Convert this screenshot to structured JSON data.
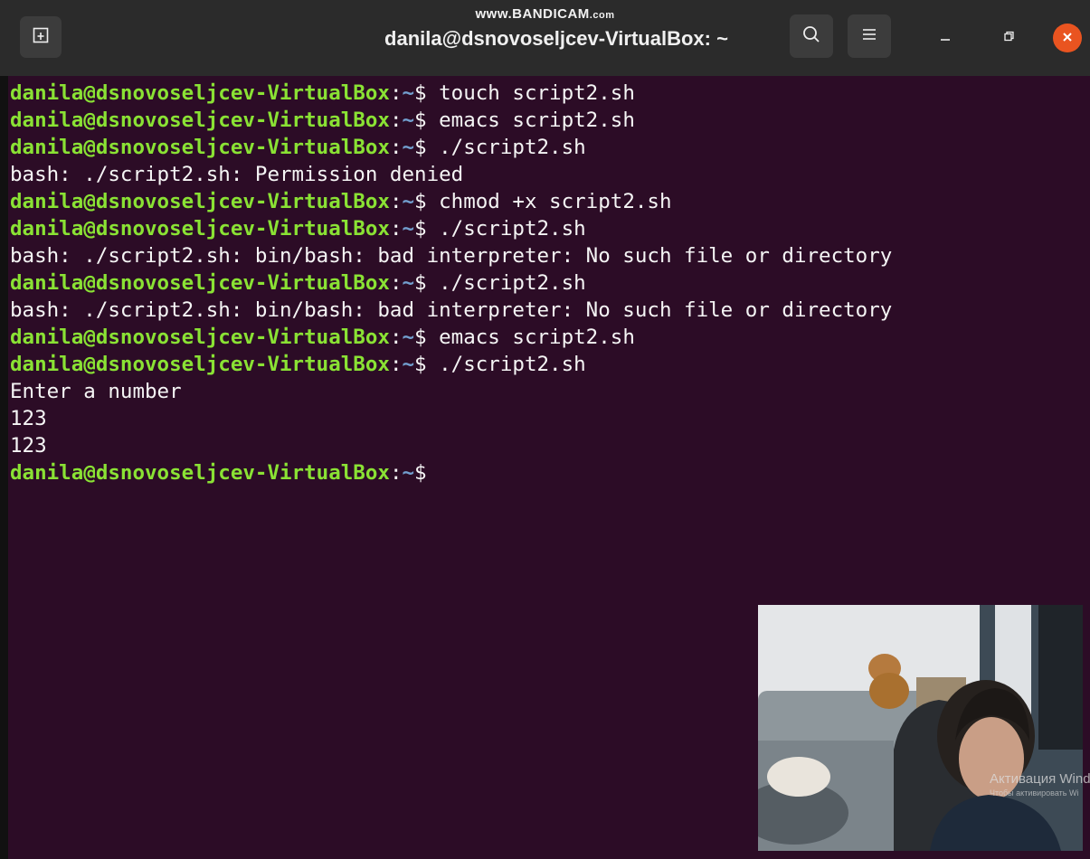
{
  "recorder": {
    "watermark_main": "www.BANDICAM",
    "watermark_suffix": ".com"
  },
  "window": {
    "title": "danila@dsnovoseljcev-VirtualBox: ~",
    "buttons": [
      "new-tab",
      "search",
      "menu",
      "minimize",
      "maximize",
      "close"
    ],
    "colors": {
      "titlebar": "#2b2b2b",
      "background": "#2c0c26",
      "close": "#e95420"
    }
  },
  "prompt": {
    "user": "danila@dsnovoseljcev-VirtualBox",
    "colon": ":",
    "path": "~",
    "symbol": "$ "
  },
  "terminal": {
    "colors": {
      "user": "#8ae234",
      "path": "#729fcf",
      "text": "#f5f5f5"
    },
    "lines": [
      {
        "prompt": true,
        "command": "touch script2.sh"
      },
      {
        "prompt": true,
        "command": "emacs script2.sh"
      },
      {
        "prompt": true,
        "command": "./script2.sh"
      },
      {
        "prompt": false,
        "text": "bash: ./script2.sh: Permission denied"
      },
      {
        "prompt": true,
        "command": "chmod +x script2.sh"
      },
      {
        "prompt": true,
        "command": "./script2.sh"
      },
      {
        "prompt": false,
        "text": "bash: ./script2.sh: bin/bash: bad interpreter: No such file or directory"
      },
      {
        "prompt": true,
        "command": "./script2.sh"
      },
      {
        "prompt": false,
        "text": "bash: ./script2.sh: bin/bash: bad interpreter: No such file or directory"
      },
      {
        "prompt": true,
        "command": "emacs script2.sh"
      },
      {
        "prompt": true,
        "command": "./script2.sh"
      },
      {
        "prompt": false,
        "text": "Enter a number"
      },
      {
        "prompt": false,
        "text": "123"
      },
      {
        "prompt": false,
        "text": "123"
      },
      {
        "prompt": true,
        "command": ""
      }
    ]
  },
  "overlay": {
    "activation_title": "Активация Windov",
    "activation_subtitle": "Чтобы активировать Wi"
  }
}
